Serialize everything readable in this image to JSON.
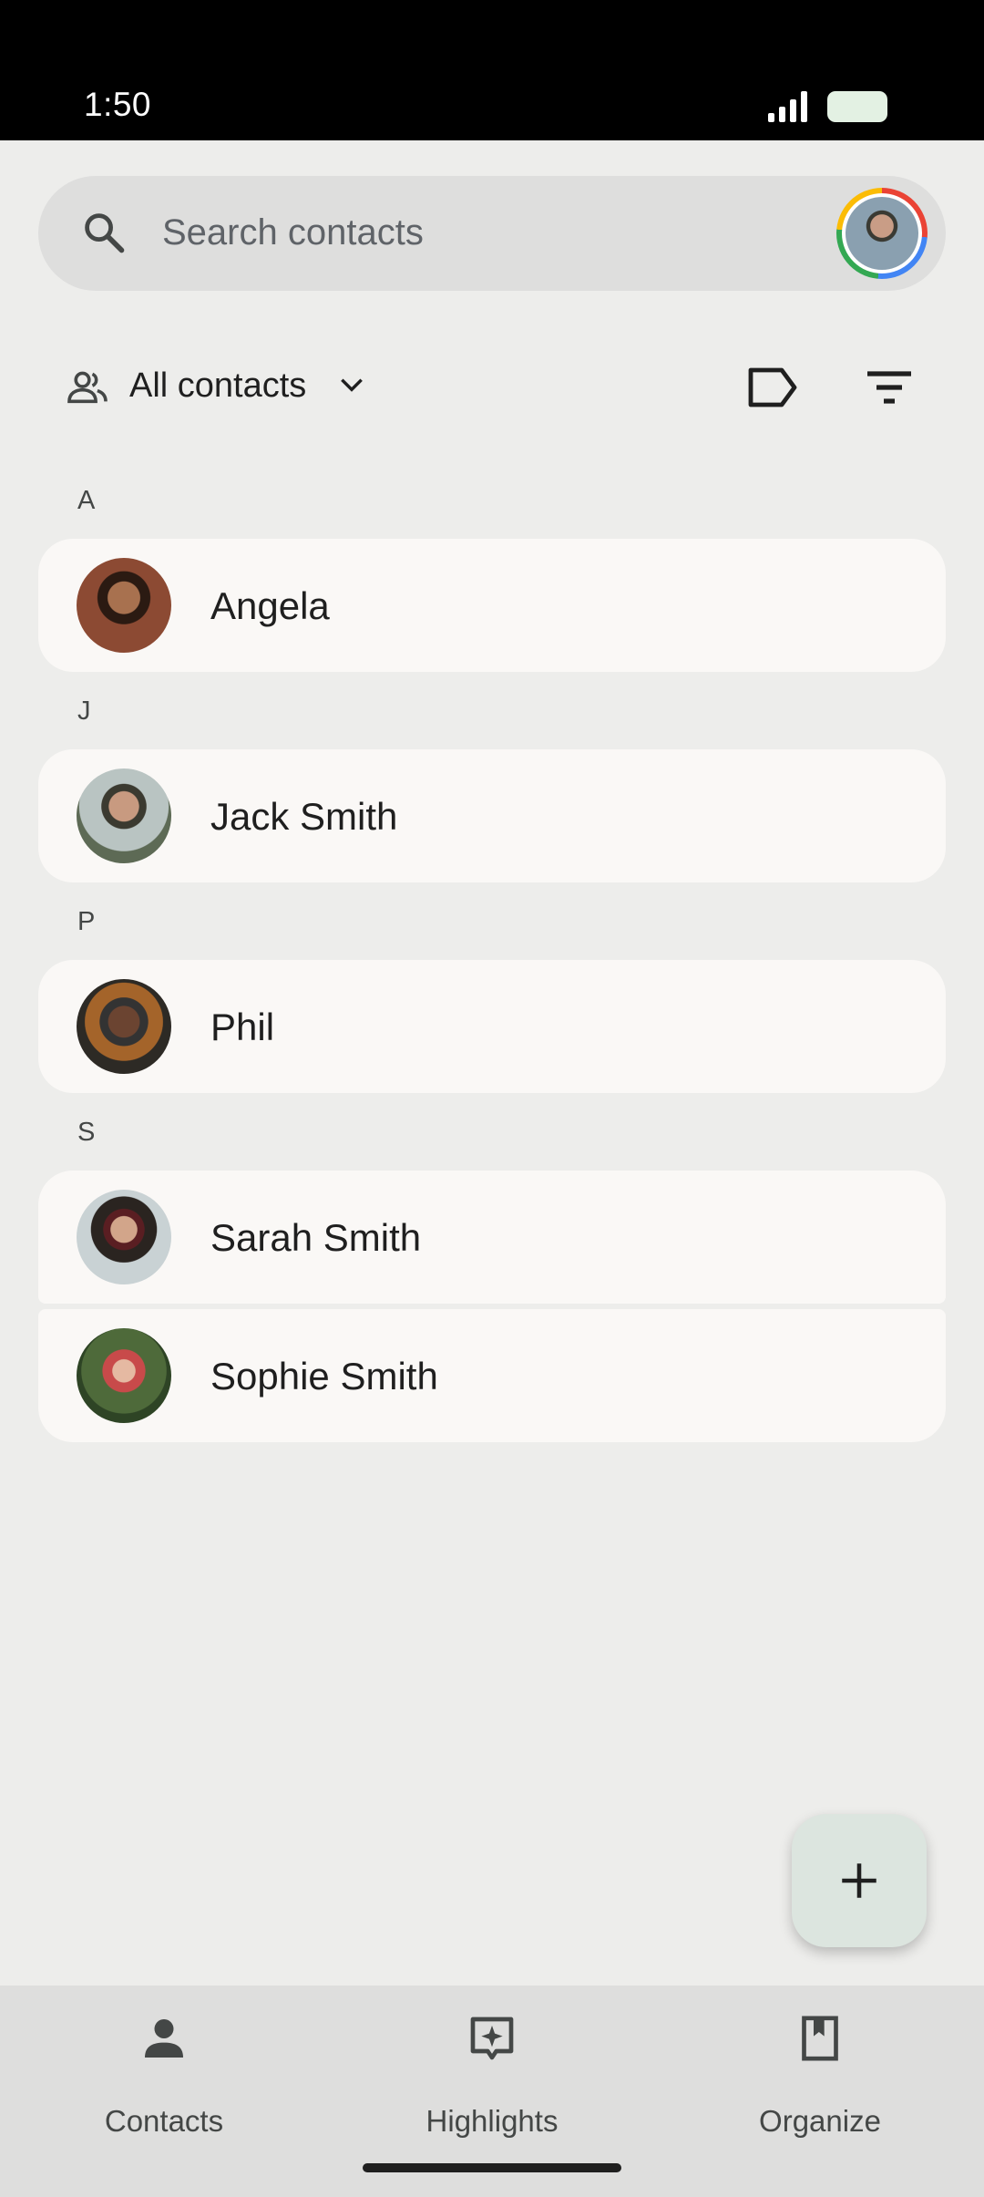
{
  "status_bar": {
    "time": "1:50"
  },
  "search": {
    "placeholder": "Search contacts"
  },
  "filter": {
    "label": "All contacts"
  },
  "sections": [
    {
      "letter": "A",
      "contacts": [
        {
          "name": "Angela",
          "avatar": "angela-photo"
        }
      ]
    },
    {
      "letter": "J",
      "contacts": [
        {
          "name": "Jack Smith",
          "avatar": "jack-photo"
        }
      ]
    },
    {
      "letter": "P",
      "contacts": [
        {
          "name": "Phil",
          "avatar": "phil-photo"
        }
      ]
    },
    {
      "letter": "S",
      "contacts": [
        {
          "name": "Sarah Smith",
          "avatar": "sarah-photo"
        },
        {
          "name": "Sophie Smith",
          "avatar": "sophie-photo"
        }
      ]
    }
  ],
  "bottom_nav": [
    {
      "label": "Contacts",
      "icon": "person-icon",
      "active": true
    },
    {
      "label": "Highlights",
      "icon": "sparkle-icon",
      "active": false
    },
    {
      "label": "Organize",
      "icon": "bookmark-icon",
      "active": false
    }
  ],
  "colors": {
    "background": "#ededeb",
    "card": "#faf8f6",
    "search_bar": "#dededd",
    "fab": "#dce5df"
  }
}
